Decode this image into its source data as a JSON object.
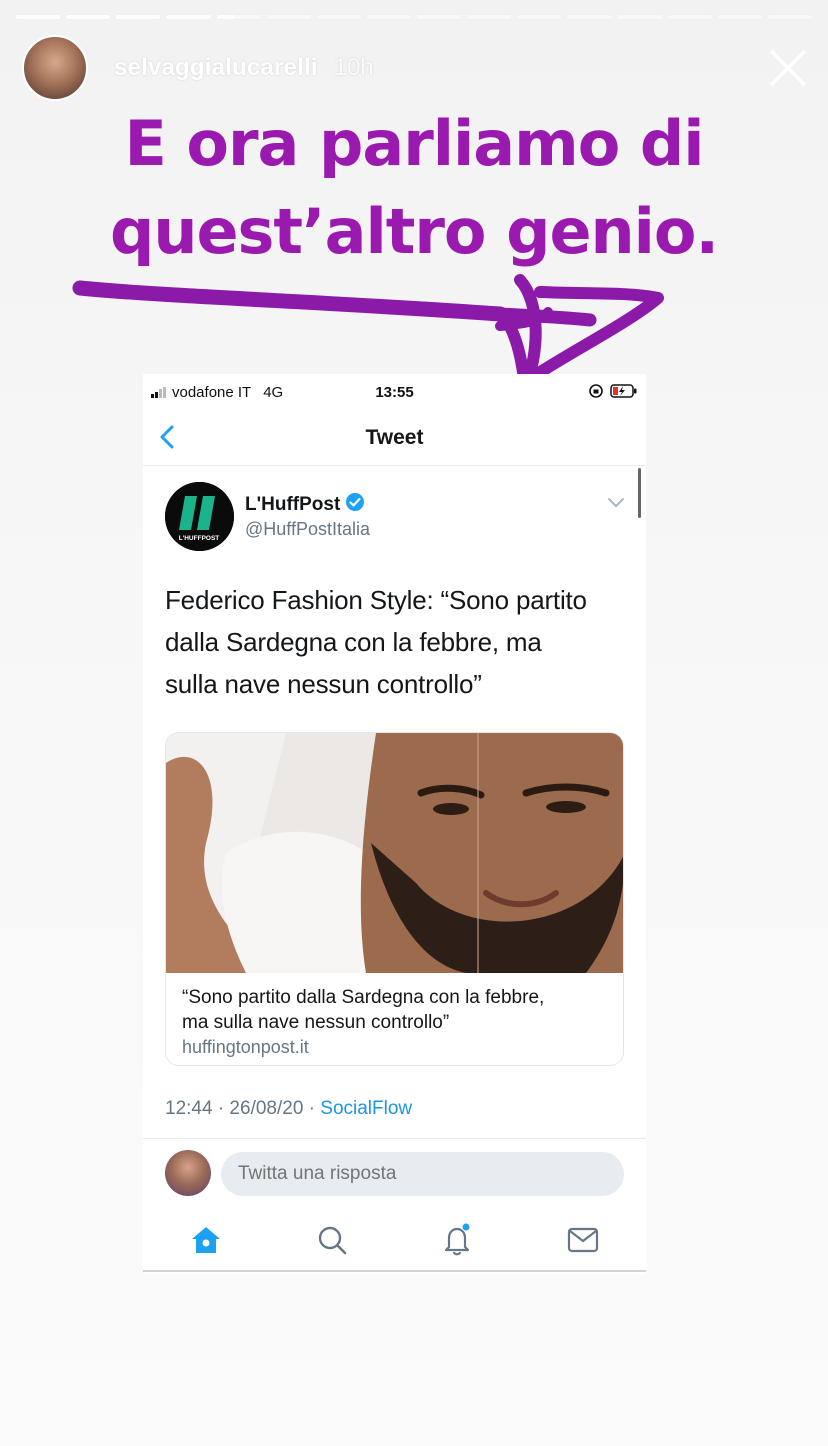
{
  "story": {
    "progress_segments": 16,
    "segments_done": 4,
    "username": "selvaggialucarelli",
    "time": "10h",
    "caption_line1": "E ora parliamo di",
    "caption_line2": "quest’altro genio.",
    "colors": {
      "caption": "#9a1ab0"
    }
  },
  "statusbar": {
    "carrier": "vodafone IT",
    "network": "4G",
    "time": "13:55"
  },
  "nav": {
    "title": "Tweet"
  },
  "tweet": {
    "author_name": "L'HuffPost",
    "handle": "@HuffPostItalia",
    "avatar_label": "L'HUFFPOST",
    "text_line1": "Federico Fashion Style: “Sono partito",
    "text_line2": "dalla Sardegna con la febbre, ma",
    "text_line3": "sulla nave nessun controllo”",
    "card": {
      "title_line1": "“Sono partito dalla Sardegna con la febbre,",
      "title_line2": "ma sulla nave nessun controllo”",
      "domain": "huffingtonpost.it"
    },
    "time": "12:44 · 26/08/20 · ",
    "source": "SocialFlow"
  },
  "reply": {
    "placeholder": "Twitta una risposta"
  },
  "tabbar": {
    "items": [
      "home-icon",
      "search-icon",
      "notifications-icon",
      "messages-icon"
    ],
    "accent": "#1da1f2"
  }
}
